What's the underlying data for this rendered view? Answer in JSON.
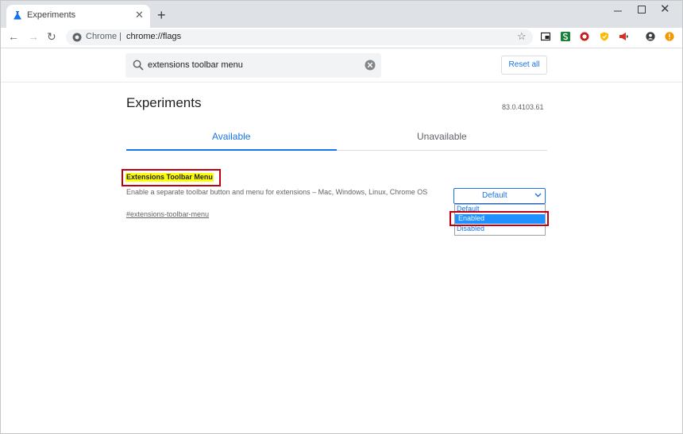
{
  "browser": {
    "tab": {
      "title": "Experiments",
      "close_glyph": "✕"
    },
    "new_tab_glyph": "+",
    "window_close_glyph": "✕",
    "nav": {
      "back": "←",
      "forward": "→",
      "reload": "↻"
    },
    "omnibox": {
      "label": "Chrome |",
      "url": "chrome://flags"
    },
    "star_glyph": "☆"
  },
  "flags_page": {
    "search": {
      "value": "extensions toolbar menu"
    },
    "reset_label": "Reset all",
    "title": "Experiments",
    "version": "83.0.4103.61",
    "tabs": [
      {
        "label": "Available",
        "active": true
      },
      {
        "label": "Unavailable",
        "active": false
      }
    ],
    "flag": {
      "title": "Extensions Toolbar Menu",
      "description": "Enable a separate toolbar button and menu for extensions – Mac, Windows, Linux, Chrome OS",
      "link": "#extensions-toolbar-menu",
      "select_value": "Default",
      "options": [
        "Default",
        "Enabled",
        "Disabled"
      ],
      "highlighted_option": "Enabled"
    }
  },
  "icons": {
    "tab": "flask-icon",
    "omnibox": "chrome-info-icon",
    "search": "search-icon",
    "clear": "clear-icon",
    "extensions": [
      "picture-in-picture-icon",
      "green-extension-icon",
      "red-circle-extension-icon",
      "yellow-shield-extension-icon",
      "megaphone-extension-icon",
      "profile-icon",
      "update-badge-icon"
    ]
  },
  "colors": {
    "accent": "#1a73e8",
    "highlight": "#ffff00",
    "annotation_red": "#c00010",
    "selected_option": "#1e90ff"
  }
}
